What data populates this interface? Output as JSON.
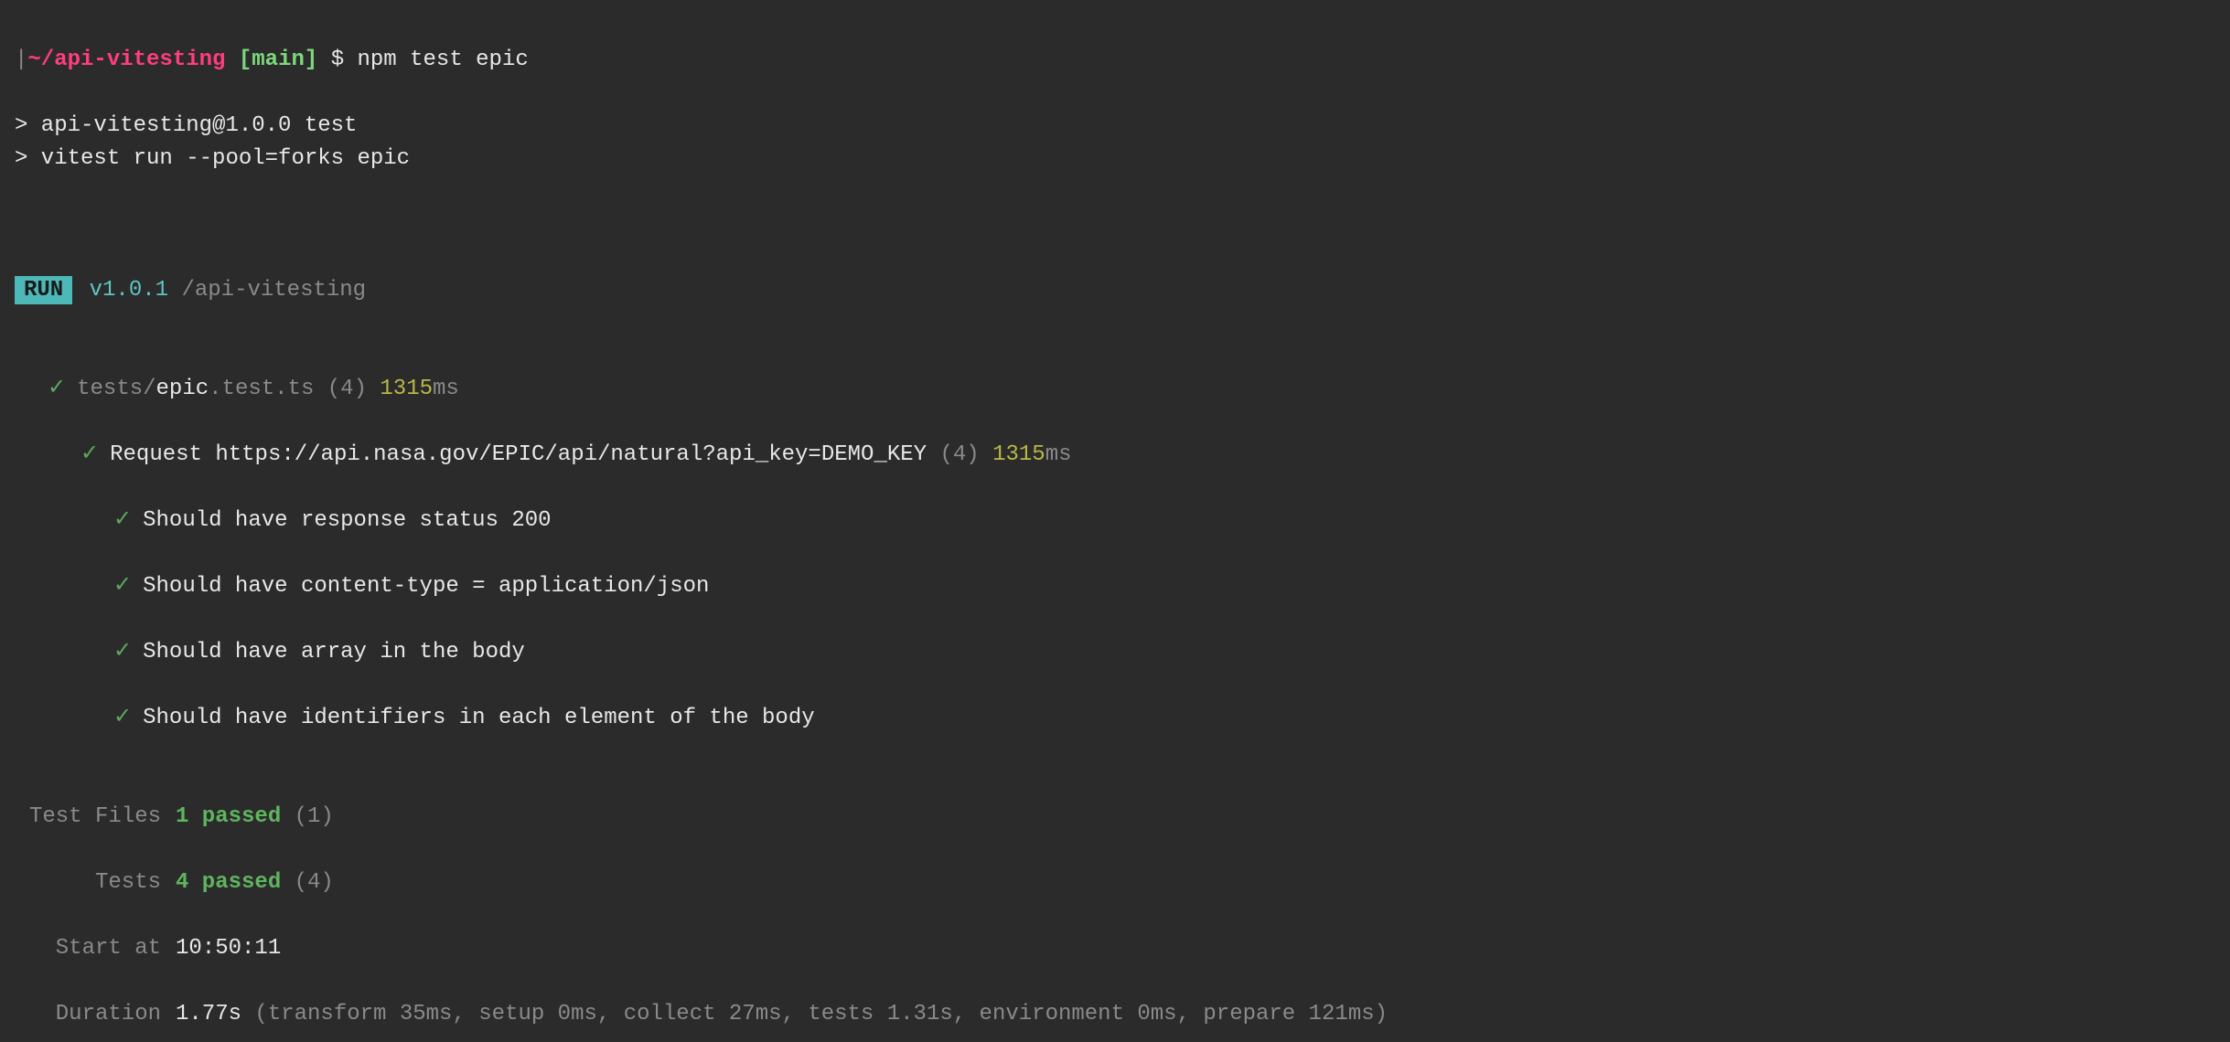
{
  "prompt": {
    "bracket": "|",
    "path": "~/api-vitesting",
    "branch_open": "[",
    "branch": "main",
    "branch_close": "]",
    "dollar": "$",
    "command": "npm test epic"
  },
  "npm": {
    "line1": "> api-vitesting@1.0.0 test",
    "line2": "> vitest run --pool=forks epic"
  },
  "runner": {
    "badge": "RUN",
    "version": "v1.0.1",
    "path": "/api-vitesting"
  },
  "testfile": {
    "prefix": "tests/",
    "name": "epic",
    "suffix": ".test.ts",
    "count": "(4)",
    "duration_num": "1315",
    "duration_unit": "ms"
  },
  "suite": {
    "name": "Request https://api.nasa.gov/EPIC/api/natural?api_key=DEMO_KEY",
    "count": "(4)",
    "duration_num": "1315",
    "duration_unit": "ms"
  },
  "tests": [
    "Should have response status 200",
    "Should have content-type = application/json",
    "Should have array in the body",
    "Should have identifiers in each element of the body"
  ],
  "summary": {
    "files_label": "Test Files",
    "files_passed": "1 passed",
    "files_count": "(1)",
    "tests_label": "Tests",
    "tests_passed": "4 passed",
    "tests_count": "(4)",
    "start_label": "Start at",
    "start_time": "10:50:11",
    "duration_label": "Duration",
    "duration_value": "1.77s",
    "duration_details": "(transform 35ms, setup 0ms, collect 27ms, tests 1.31s, environment 0ms, prepare 121ms)"
  },
  "check": "✓"
}
